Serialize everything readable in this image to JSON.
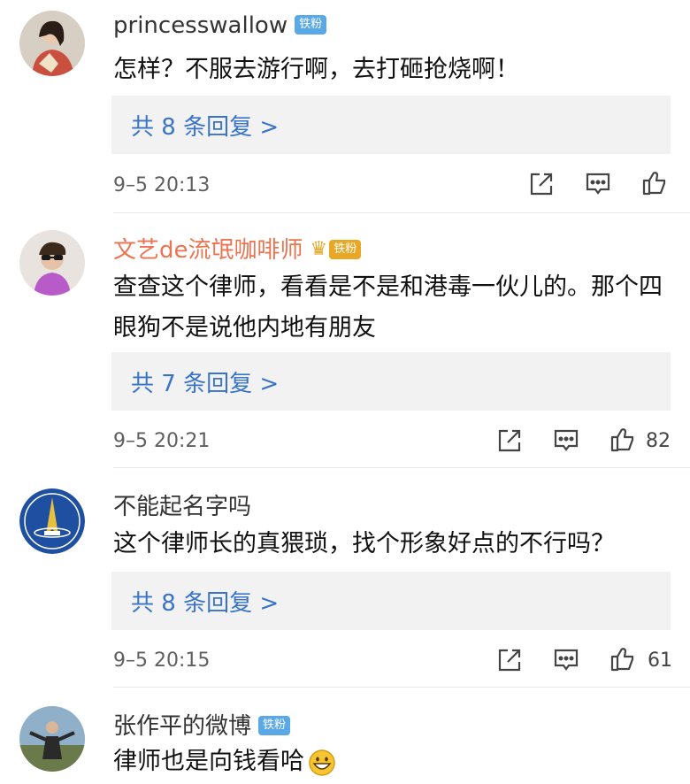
{
  "comments": [
    {
      "username": "princesswallow",
      "badge": "铁粉",
      "text": "怎样？不服去游行啊，去打砸抢烧啊！",
      "replies": "共 8 条回复 >",
      "time": "9–5 20:13",
      "likes": "",
      "avatar_icon": "woman-photo"
    },
    {
      "username": "文艺de流氓咖啡师",
      "badge": "铁粉",
      "text": "查查这个律师，看看是不是和港毒一伙儿的。那个四眼狗不是说他内地有朋友",
      "replies": "共 7 条回复 >",
      "time": "9–5 20:21",
      "likes": "82",
      "avatar_icon": "man-sunglasses-photo"
    },
    {
      "username": "不能起名字吗",
      "badge": "",
      "text": "这个律师长的真猥琐，找个形象好点的不行吗？",
      "replies": "共 8 条回复 >",
      "time": "9–5 20:15",
      "likes": "61",
      "avatar_icon": "astronaut-center-logo"
    },
    {
      "username": "张作平的微博",
      "badge": "铁粉",
      "text": "律师也是向钱看哈",
      "emoji": "grinning-face",
      "avatar_icon": "man-outdoor-photo"
    }
  ],
  "icons": {
    "share": "share-icon",
    "comment": "comment-icon",
    "like": "thumbs-up-icon"
  },
  "colors": {
    "link": "#3a74c8",
    "vip_name": "#eb7350",
    "badge": "#5aa9e6",
    "reply_bg": "#f2f2f2"
  }
}
